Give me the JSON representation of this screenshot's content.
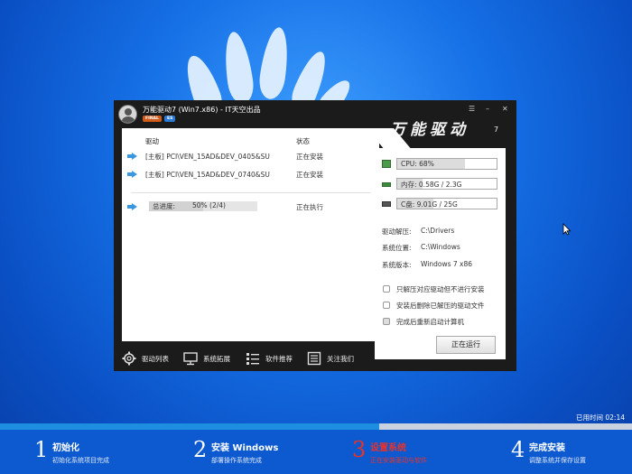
{
  "window": {
    "title": "万能驱动7 (Win7.x86) - IT天空出品",
    "badge_final": "FINAL",
    "badge_edition": "ES",
    "controls": {
      "menu": "☰",
      "minimize": "–",
      "close": "✕"
    },
    "brand": "万能驱动",
    "brand_version": "7"
  },
  "driver_list": {
    "header_driver": "驱动",
    "header_status": "状态",
    "rows": [
      {
        "name": "[主板] PCI\\VEN_15AD&DEV_0405&SU",
        "status": "正在安装"
      },
      {
        "name": "[主板] PCI\\VEN_15AD&DEV_0740&SU",
        "status": "正在安装"
      }
    ],
    "total_label": "总进度:",
    "total_value": "50% (2/4)",
    "total_fraction": 0.5,
    "total_status": "正在执行"
  },
  "resources": {
    "cpu": {
      "label": "CPU: 68%",
      "fraction": 0.68
    },
    "memory": {
      "label": "内存: 0.58G / 2.3G",
      "fraction": 0.25
    },
    "disk": {
      "label": "C盘: 9.01G / 25G",
      "fraction": 0.36
    }
  },
  "info": {
    "extract_label": "驱动解压:",
    "extract_value": "C:\\Drivers",
    "system_location_label": "系统位置:",
    "system_location_value": "C:\\Windows",
    "system_version_label": "系统版本:",
    "system_version_value": "Windows 7 x86"
  },
  "options": [
    {
      "label": "只解压对应驱动但不进行安装",
      "checked": false
    },
    {
      "label": "安装后删除已解压的驱动文件",
      "checked": false
    },
    {
      "label": "完成后重新启动计算机",
      "checked": false
    }
  ],
  "run_button": "正在运行",
  "bottom_tabs": [
    {
      "label": "驱动列表",
      "icon": "gear-icon"
    },
    {
      "label": "系统拓展",
      "icon": "monitor-icon"
    },
    {
      "label": "软件推荐",
      "icon": "list-icon"
    },
    {
      "label": "关注我们",
      "icon": "document-icon"
    }
  ],
  "elapsed": "已用时间 02:14",
  "overall_progress_fraction": 0.6,
  "steps": [
    {
      "num": "1",
      "title": "初始化",
      "desc": "初始化系统项目完成",
      "active": false
    },
    {
      "num": "2",
      "title": "安装 Windows",
      "desc": "部署操作系统完成",
      "active": false
    },
    {
      "num": "3",
      "title": "设置系统",
      "desc": "正在安装驱动与软件",
      "active": true
    },
    {
      "num": "4",
      "title": "完成安装",
      "desc": "调整系统并保存设置",
      "active": false
    }
  ],
  "colors": {
    "desktop_blue": "#1670e6",
    "window_bg": "#1b1b1b",
    "accent_blue": "#3a98e0",
    "active_step": "#e8322a",
    "progress_fill": "#1e8ee0"
  }
}
